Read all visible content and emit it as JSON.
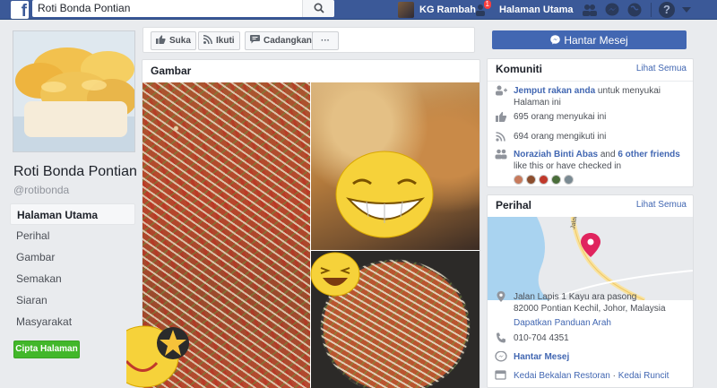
{
  "topbar": {
    "search_value": "Roti Bonda Pontian",
    "user_name": "KG Rambah",
    "home_label": "Halaman Utama",
    "home_badge": "1"
  },
  "page": {
    "name": "Roti Bonda Pontian",
    "handle": "@rotibonda"
  },
  "leftnav": {
    "items": [
      {
        "label": "Halaman Utama"
      },
      {
        "label": "Perihal"
      },
      {
        "label": "Gambar"
      },
      {
        "label": "Semakan"
      },
      {
        "label": "Siaran"
      },
      {
        "label": "Masyarakat"
      }
    ],
    "create_label": "Cipta Halaman"
  },
  "actions": {
    "like": "Suka",
    "follow": "Ikuti",
    "share": "Cadangkan",
    "more": "···",
    "message": "Hantar Mesej"
  },
  "gallery": {
    "title": "Gambar"
  },
  "community": {
    "title": "Komuniti",
    "see_all": "Lihat Semua",
    "invite_link": "Jemput rakan anda",
    "invite_rest": " untuk menyukai Halaman ini",
    "likes": "695 orang menyukai ini",
    "follows": "694 orang mengikuti ini",
    "friend_name": "Noraziah Binti Abas",
    "friend_and": " and ",
    "friend_others": "6 other friends",
    "friend_rest": " like this or have checked in"
  },
  "about": {
    "title": "Perihal",
    "see_all": "Lihat Semua",
    "address_line1": "Jalan Lapis 1 Kayu ara pasong",
    "address_line2": "82000 Pontian Kechil, Johor, Malaysia",
    "directions": "Dapatkan Panduan Arah",
    "phone": "010-704 4351",
    "message": "Hantar Mesej",
    "category_1": "Kedai Bekalan Restoran",
    "category_sep": " · ",
    "category_2": "Kedai Runcit"
  },
  "colors": {
    "brand": "#3b5998",
    "link": "#4267b2",
    "create": "#42b72a",
    "pin": "#e0245e"
  }
}
